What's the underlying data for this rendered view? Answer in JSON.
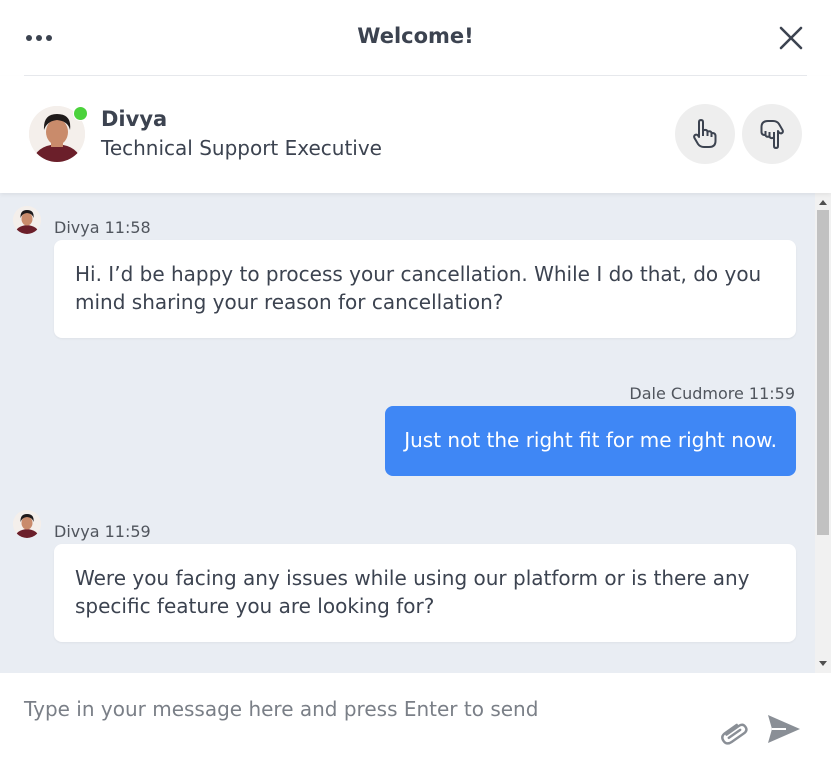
{
  "header": {
    "title": "Welcome!",
    "more_icon": "more-horizontal-icon",
    "close_icon": "close-icon"
  },
  "agent": {
    "name": "Divya",
    "role": "Technical Support Executive",
    "status": "online",
    "status_color": "#4bd23b",
    "rate_up_icon": "thumbs-up-icon",
    "rate_down_icon": "thumbs-down-icon"
  },
  "messages": [
    {
      "sender": "Divya",
      "time": "11:58",
      "meta": "Divya 11:58",
      "direction": "incoming",
      "text": "Hi. I’d be happy to process your cancellation. While I do that, do you mind sharing your reason for cancellation?"
    },
    {
      "sender": "Dale Cudmore",
      "time": "11:59",
      "meta": "Dale Cudmore 11:59",
      "direction": "outgoing",
      "text": "Just not the right fit for me right now."
    },
    {
      "sender": "Divya",
      "time": "11:59",
      "meta": "Divya 11:59",
      "direction": "incoming",
      "text": "Were you facing any issues while using our platform or is there any specific feature you are looking for?"
    }
  ],
  "composer": {
    "placeholder": "Type in your message here and press Enter to send",
    "value": "",
    "attach_icon": "paperclip-icon",
    "send_icon": "send-icon"
  },
  "colors": {
    "accent": "#3f87f5",
    "messages_bg": "#e9edf3",
    "text": "#3c4350"
  }
}
